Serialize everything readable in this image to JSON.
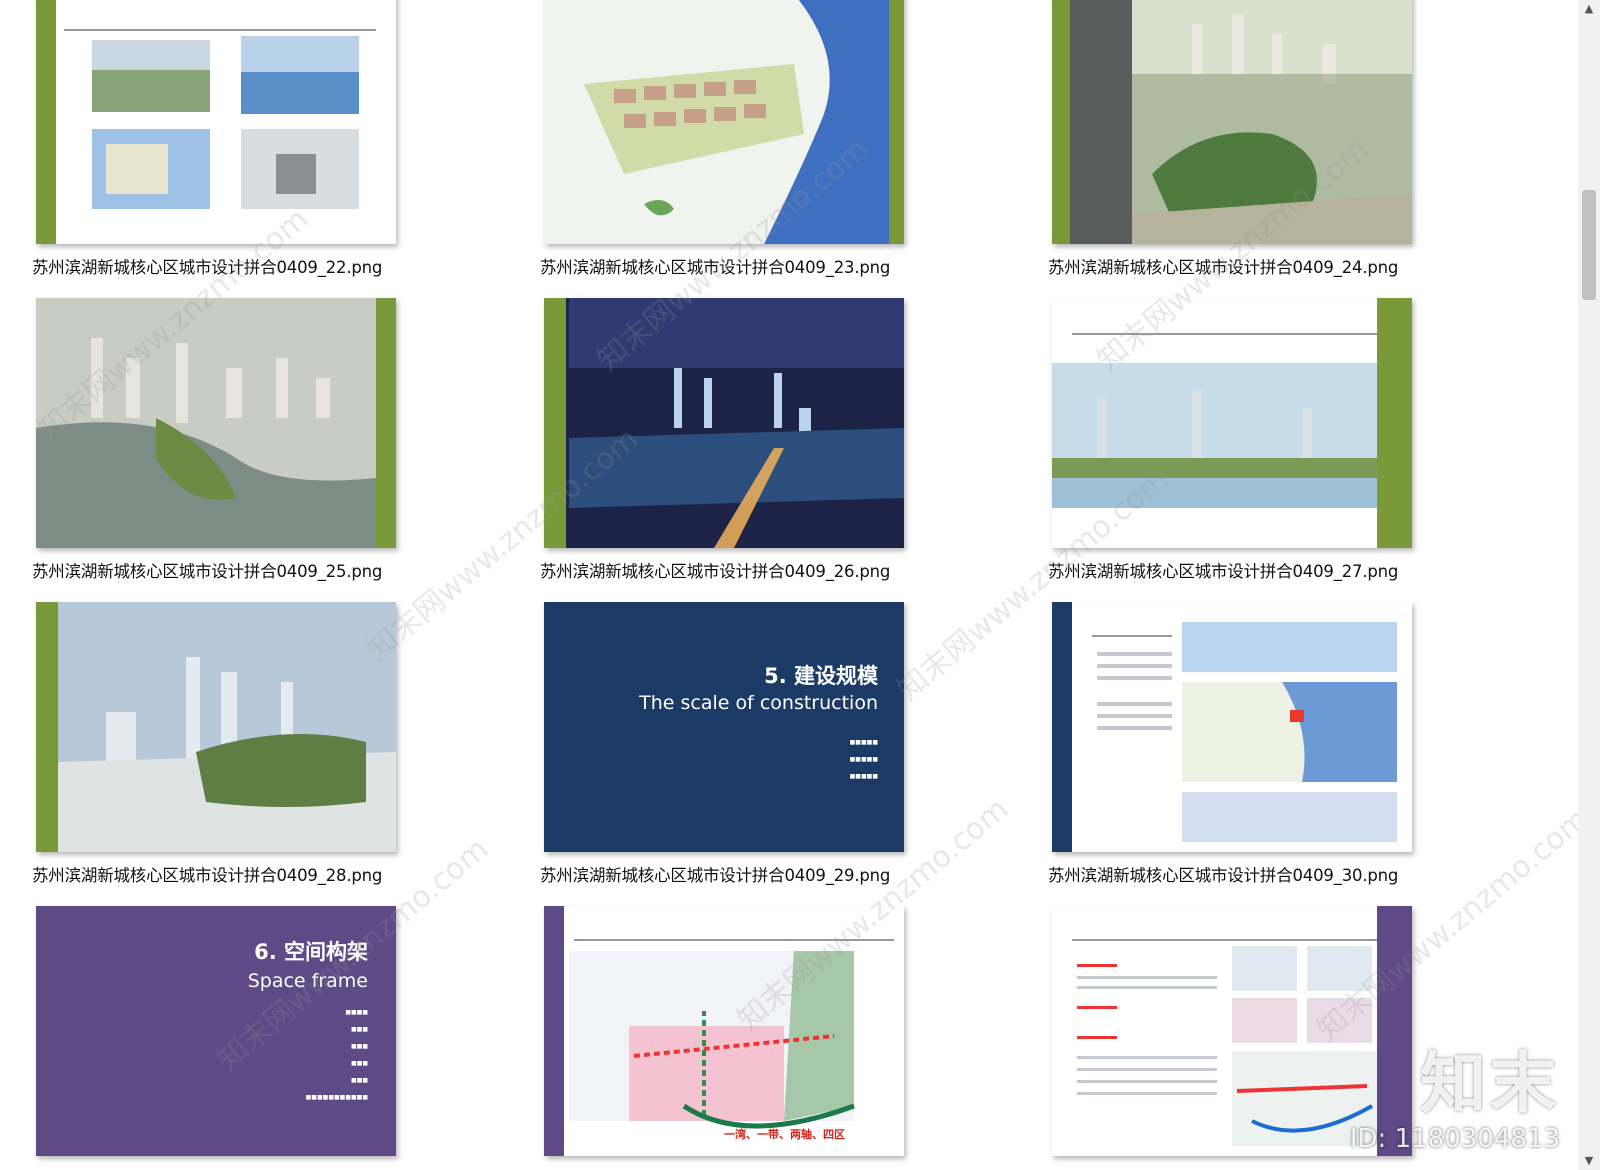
{
  "files": [
    {
      "name": "苏州滨湖新城核心区城市设计拼合0409_22.png",
      "thumb": "collage"
    },
    {
      "name": "苏州滨湖新城核心区城市设计拼合0409_23.png",
      "thumb": "plan-map"
    },
    {
      "name": "苏州滨湖新城核心区城市设计拼合0409_24.png",
      "thumb": "aerial-island"
    },
    {
      "name": "苏州滨湖新城核心区城市设计拼合0409_25.png",
      "thumb": "aerial-city"
    },
    {
      "name": "苏州滨湖新城核心区城市设计拼合0409_26.png",
      "thumb": "night-city"
    },
    {
      "name": "苏州滨湖新城核心区城市设计拼合0409_27.png",
      "thumb": "skyline"
    },
    {
      "name": "苏州滨湖新城核心区城市设计拼合0409_28.png",
      "thumb": "towers-mist"
    },
    {
      "name": "苏州滨湖新城核心区城市设计拼合0409_29.png",
      "thumb": "section-blue"
    },
    {
      "name": "苏州滨湖新城核心区城市设计拼合0409_30.png",
      "thumb": "scale-sheet"
    },
    {
      "name": "",
      "thumb": "section-purple"
    },
    {
      "name": "",
      "thumb": "axis-map"
    },
    {
      "name": "",
      "thumb": "frame-sheet"
    }
  ],
  "slides": {
    "section5": {
      "title_zh": "5. 建设规模",
      "title_en": "The scale of construction"
    },
    "section6": {
      "title_zh": "6. 空间构架",
      "title_en": "Space frame"
    },
    "axis_map_slogan": "一湾、一带、两轴、四区"
  },
  "watermark": {
    "text": "知末网www.znzmo.com"
  },
  "brand": {
    "logo": "知末",
    "id": "ID: 1180304813"
  },
  "colors": {
    "green_band": "#7a9a3a",
    "navy": "#1b3a66",
    "purple": "#5d4a86",
    "water": "#3f6fc0"
  }
}
